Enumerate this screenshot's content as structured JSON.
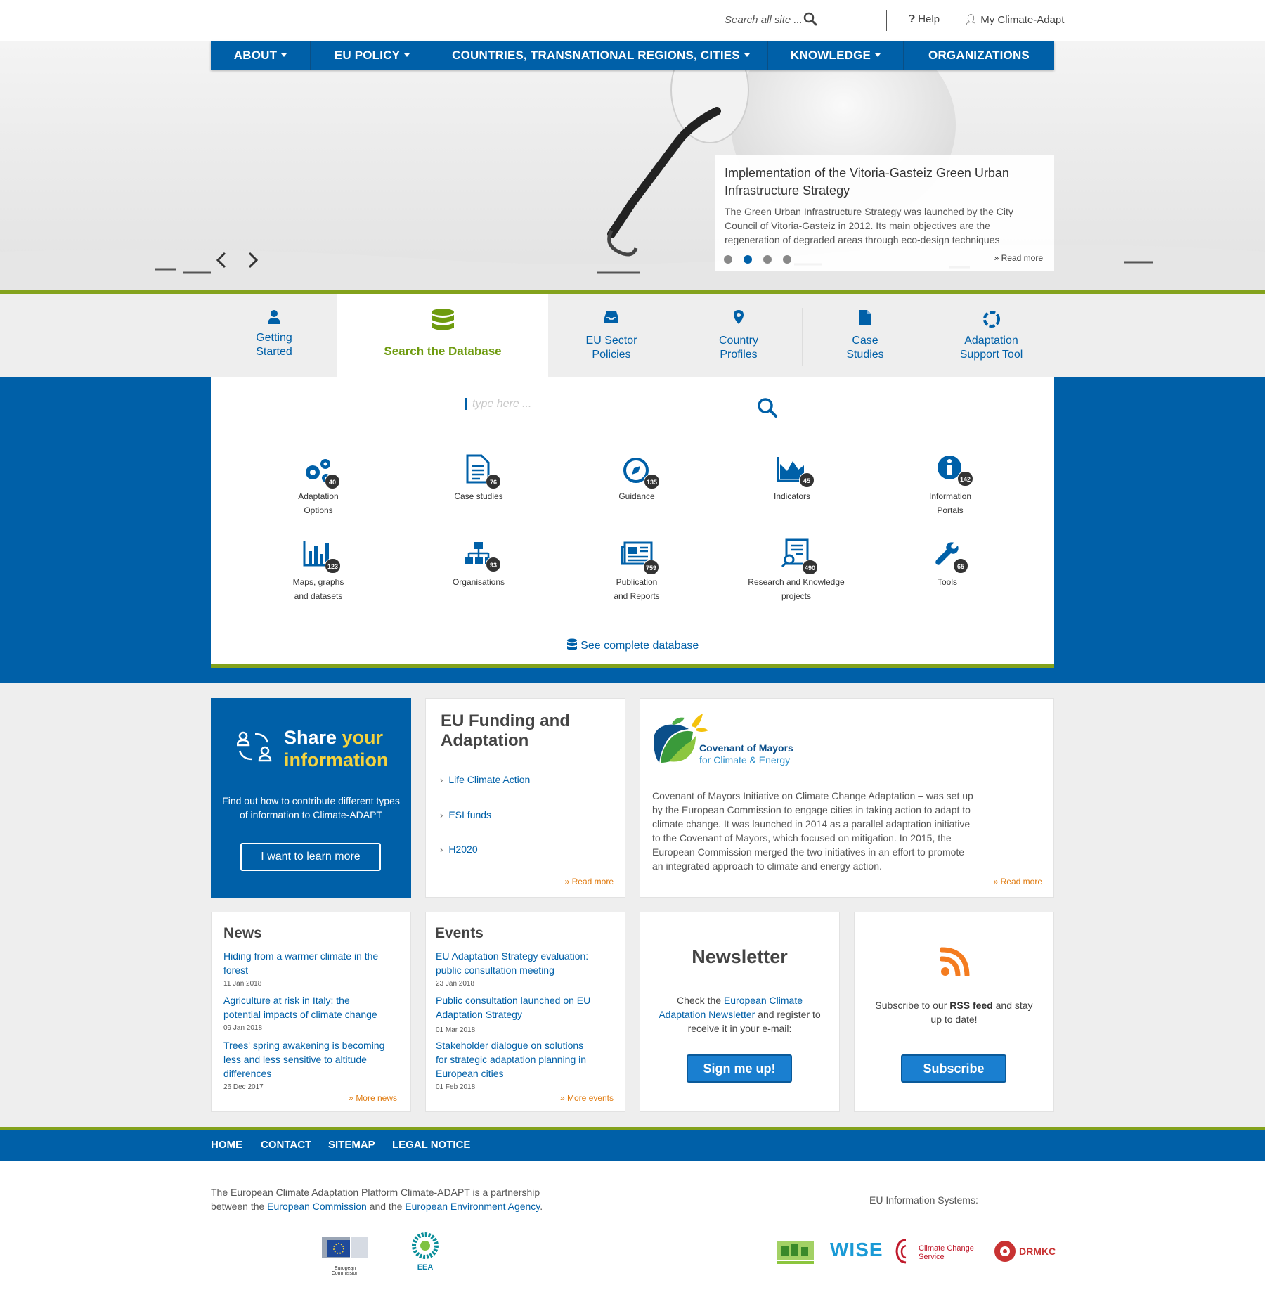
{
  "topbar": {
    "search_placeholder": "Search all site ...",
    "help": "Help",
    "my_account": "My Climate-Adapt"
  },
  "nav": {
    "items": [
      {
        "label": "ABOUT",
        "dropdown": true
      },
      {
        "label": "EU POLICY",
        "dropdown": true
      },
      {
        "label": "COUNTRIES, TRANSNATIONAL REGIONS, CITIES",
        "dropdown": true
      },
      {
        "label": "KNOWLEDGE",
        "dropdown": true
      },
      {
        "label": "ORGANIZATIONS",
        "dropdown": false
      }
    ]
  },
  "slider": {
    "title": "Implementation of the Vitoria-Gasteiz Green Urban Infrastructure Strategy",
    "text": "The Green Urban Infrastructure Strategy was launched by the City Council of Vitoria-Gasteiz in 2012. Its main objectives are the regeneration of degraded areas through eco-design techniques",
    "read_more": "Read more",
    "slide_count": 4,
    "active_slide": 2
  },
  "tabs": [
    {
      "label": "Getting Started",
      "icon": "user-icon"
    },
    {
      "label": "Search the Database",
      "icon": "database-icon",
      "active": true
    },
    {
      "label": "EU Sector Policies",
      "icon": "inbox-icon"
    },
    {
      "label": "Country Profiles",
      "icon": "map-marker-icon"
    },
    {
      "label": "Case Studies",
      "icon": "document-icon"
    },
    {
      "label": "Adaptation Support Tool",
      "icon": "cycle-icon"
    }
  ],
  "database": {
    "search_placeholder": "type here ...",
    "categories": [
      {
        "label": "Adaptation Options",
        "count": "40",
        "icon": "gears-icon"
      },
      {
        "label": "Case studies",
        "count": "76",
        "icon": "document-icon"
      },
      {
        "label": "Guidance",
        "count": "135",
        "icon": "compass-icon"
      },
      {
        "label": "Indicators",
        "count": "45",
        "icon": "area-chart-icon"
      },
      {
        "label": "Information Portals",
        "count": "142",
        "icon": "info-icon"
      },
      {
        "label": "Maps, graphs and datasets",
        "count": "123",
        "icon": "bar-chart-icon"
      },
      {
        "label": "Organisations",
        "count": "93",
        "icon": "org-chart-icon"
      },
      {
        "label": "Publication and Reports",
        "count": "759",
        "icon": "newspaper-icon"
      },
      {
        "label": "Research and Knowledge projects",
        "count": "490",
        "icon": "research-icon"
      },
      {
        "label": "Tools",
        "count": "65",
        "icon": "wrench-icon"
      }
    ],
    "complete_link": "See complete database"
  },
  "share": {
    "title_part1": "Share ",
    "title_part2": "your",
    "title_part3": "information",
    "text": "Find out how to contribute different types of information to Climate-ADAPT",
    "button": "I want to learn more"
  },
  "funding": {
    "title": "EU Funding and Adaptation",
    "links": [
      "Life Climate Action",
      "ESI funds",
      "H2020"
    ],
    "read_more": "Read more"
  },
  "covenant": {
    "logo_line1": "Covenant of Mayors",
    "logo_line2": "for Climate & Energy",
    "text": "Covenant of Mayors Initiative on Climate Change Adaptation – was set up by the European Commission to engage cities in taking action to adapt to climate change. It was launched in 2014 as a parallel adaptation initiative to the Covenant of Mayors, which focused on mitigation. In 2015, the European Commission merged the two initiatives in an effort to promote an integrated approach to climate and energy action.",
    "read_more": "Read more"
  },
  "news": {
    "title": "News",
    "items": [
      {
        "title": "Hiding from a warmer climate in the forest",
        "date": "11 Jan 2018"
      },
      {
        "title": "Agriculture at risk in Italy: the potential impacts of climate change",
        "date": "09 Jan 2018"
      },
      {
        "title": "Trees' spring awakening is becoming less and less sensitive to altitude differences",
        "date": "26 Dec 2017"
      }
    ],
    "more": "More news"
  },
  "events": {
    "title": "Events",
    "items": [
      {
        "title": "EU Adaptation  Strategy evaluation: public consultation meeting",
        "date": "23 Jan 2018"
      },
      {
        "title": "Public consultation launched on EU Adaptation Strategy",
        "date": "01 Mar 2018"
      },
      {
        "title": "Stakeholder dialogue on solutions for strategic adaptation planning in European cities",
        "date": "01 Feb 2018"
      }
    ],
    "more": "More events"
  },
  "newsletter": {
    "title": "Newsletter",
    "text_before": "Check the ",
    "link": "European Climate Adaptation Newsletter",
    "text_after": " and register to receive it in your e-mail:",
    "button": "Sign me up!"
  },
  "rss": {
    "text_before": "Subscribe to our ",
    "link": "RSS feed",
    "text_after": " and stay up to date!",
    "button": "Subscribe"
  },
  "footer": {
    "nav": [
      "HOME",
      "CONTACT",
      "SITEMAP",
      "LEGAL NOTICE"
    ],
    "text_before": "The European Climate Adaptation Platform Climate-ADAPT is a partnership between the ",
    "link1": "European Commission",
    "text_mid": " and the ",
    "link2": "European Environment Agency",
    "text_after": ".",
    "eu_systems_label": "EU Information Systems:",
    "logos": {
      "ec": "European Commission",
      "eea": "EEA",
      "wise": "WISE",
      "ccs_line1": "Climate Change",
      "ccs_line2": "Service",
      "drmkc": "DRMKC"
    }
  },
  "colors": {
    "primary_blue": "#0060a8",
    "accent_green": "#83a21c",
    "read_more_orange": "#e07b10",
    "highlight_yellow": "#f4d23e"
  }
}
